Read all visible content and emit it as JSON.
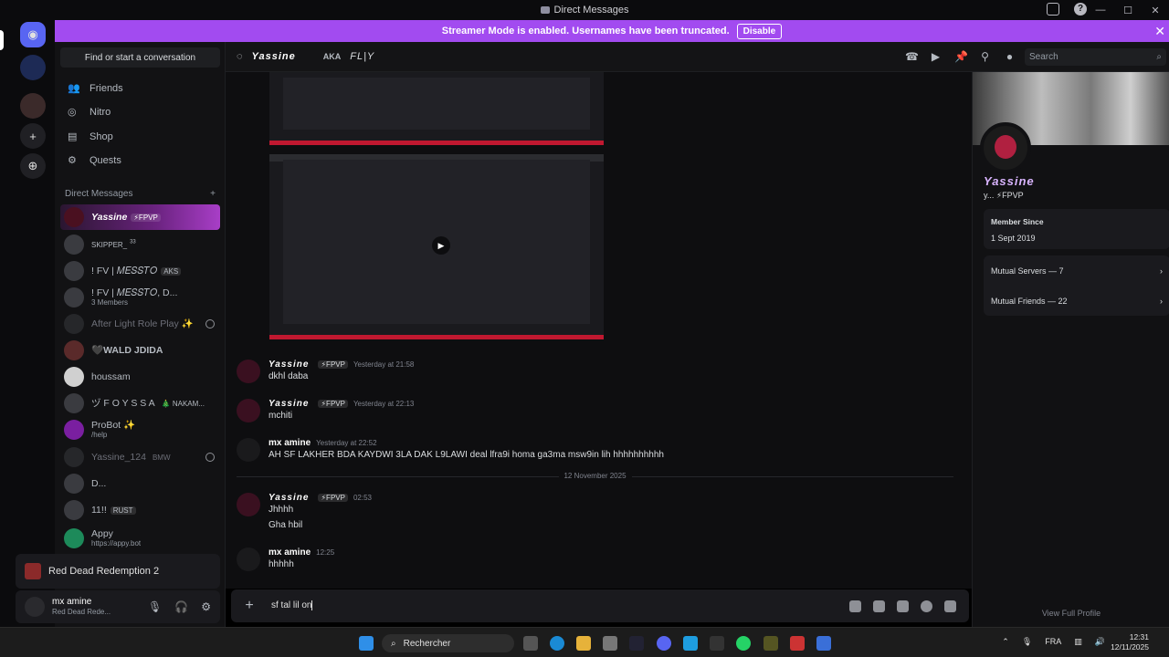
{
  "window": {
    "title": "Direct Messages"
  },
  "banner": {
    "text": "Streamer Mode is enabled. Usernames have been truncated.",
    "button": "Disable"
  },
  "sidebar": {
    "find": "Find or start a conversation",
    "nav": [
      "Friends",
      "Nitro",
      "Shop",
      "Quests"
    ],
    "dm_header": "Direct Messages",
    "dms": [
      {
        "name": "Yassine",
        "tag": "⚡FPVP"
      },
      {
        "name": "SKIPPER_",
        "tag": "33"
      },
      {
        "name": "! FV | 𝑀𝐸𝑆𝑆𝑇𝑂",
        "tag": "AKS"
      },
      {
        "name": "! FV | 𝑀𝐸𝑆𝑆𝑇𝑂, D...",
        "sub": "3 Members"
      },
      {
        "name": "After Light Role Play ✨"
      },
      {
        "name": "🖤WALD JDIDA"
      },
      {
        "name": "houssam"
      },
      {
        "name": "ヅ F O Y S S A",
        "tag": "🎄 NAKAM..."
      },
      {
        "name": "ProBot ✨",
        "sub": "/help"
      },
      {
        "name": "Yassine_124",
        "tag": "BMW"
      },
      {
        "name": "D..."
      },
      {
        "name": "11!!",
        "tag": "RUST"
      },
      {
        "name": "Appy",
        "sub": "https://appy.bot"
      }
    ],
    "activity": "Red Dead Redemption 2",
    "user": {
      "name": "mx amine",
      "status": "Red Dead Rede..."
    }
  },
  "chat_header": {
    "name": "Yassine",
    "aka": "AKA",
    "nick": "FL|Y",
    "search": "Search"
  },
  "messages": [
    {
      "author": "Yassine",
      "tag": "⚡FPVP",
      "time": "Yesterday at 21:58",
      "lines": [
        "dkhl daba"
      ]
    },
    {
      "author": "Yassine",
      "tag": "⚡FPVP",
      "time": "Yesterday at 22:13",
      "lines": [
        "mchiti"
      ]
    },
    {
      "author": "mx amine",
      "time": "Yesterday at 22:52",
      "lines": [
        "AH SF LAKHER BDA KAYDWI 3LA DAK L9LAWI deal lfra9i homa ga3ma msw9in lih hhhhhhhhhh"
      ]
    },
    {
      "author": "Yassine",
      "tag": "⚡FPVP",
      "time": "02:53",
      "lines": [
        "Jhhhh",
        "Gha hbil"
      ]
    },
    {
      "author": "mx amine",
      "time": "12:25",
      "lines": [
        "hhhhh"
      ]
    }
  ],
  "separator": "12 November 2025",
  "composer": {
    "value": "sf tal lil on"
  },
  "profile": {
    "name": "Yassine",
    "tag": "y... ⚡FPVP",
    "member_since_label": "Member Since",
    "member_since": "1 Sept 2019",
    "mutual_servers": "Mutual Servers — 7",
    "mutual_friends": "Mutual Friends — 22",
    "view_full": "View Full Profile"
  },
  "taskbar": {
    "search": "Rechercher",
    "lang": "FRA",
    "time": "12:31",
    "date": "12/11/2025"
  },
  "colors": {
    "accent": "#a24bf0",
    "brand": "#5865f2",
    "bg": "#0e0e10"
  }
}
